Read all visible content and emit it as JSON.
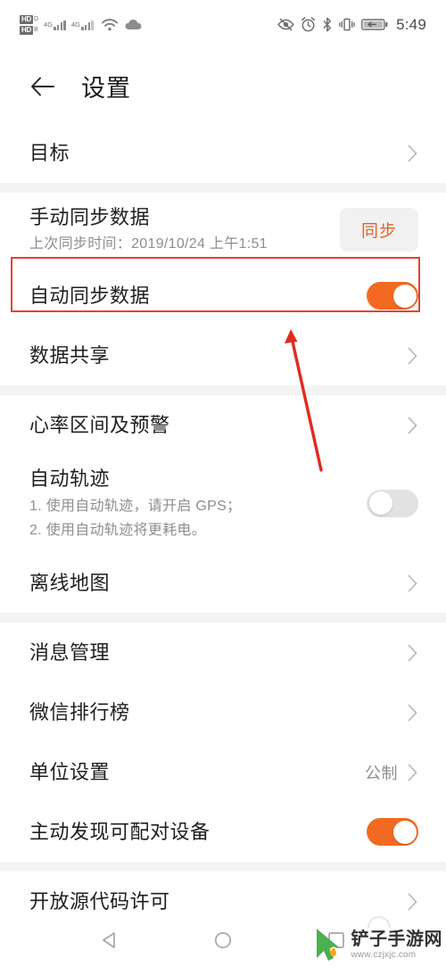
{
  "status_bar": {
    "hd_badges": [
      {
        "label": "HD",
        "sub": "D"
      },
      {
        "label": "HD",
        "sub": "B"
      }
    ],
    "network_labels": [
      "4G",
      "4G"
    ],
    "icons": [
      "wifi-icon",
      "cloud-icon",
      "eye-off-icon",
      "alarm-clock-icon",
      "bluetooth-icon",
      "vibrate-icon",
      "battery-charging-icon"
    ],
    "time": "5:49"
  },
  "header": {
    "back_icon": "back-arrow-icon",
    "title": "设置"
  },
  "sections": [
    {
      "id": "goal",
      "rows": [
        {
          "type": "link",
          "title": "目标"
        }
      ]
    },
    {
      "id": "sync",
      "rows": [
        {
          "type": "sync",
          "title": "手动同步数据",
          "subtitle": "上次同步时间：2019/10/24 上午1:51",
          "button": "同步"
        },
        {
          "type": "toggle",
          "title": "自动同步数据",
          "state": "on",
          "highlighted": true
        },
        {
          "type": "link",
          "title": "数据共享"
        }
      ]
    },
    {
      "id": "tracking",
      "rows": [
        {
          "type": "link",
          "title": "心率区间及预警"
        },
        {
          "type": "toggle-multi",
          "title": "自动轨迹",
          "lines": [
            "1. 使用自动轨迹，请开启 GPS；",
            "2. 使用自动轨迹将更耗电。"
          ],
          "state": "off"
        },
        {
          "type": "link",
          "title": "离线地图"
        }
      ]
    },
    {
      "id": "misc",
      "rows": [
        {
          "type": "link",
          "title": "消息管理"
        },
        {
          "type": "link",
          "title": "微信排行榜"
        },
        {
          "type": "value-link",
          "title": "单位设置",
          "value": "公制"
        },
        {
          "type": "toggle",
          "title": "主动发现可配对设备",
          "state": "on"
        }
      ]
    },
    {
      "id": "legal",
      "rows": [
        {
          "type": "link",
          "title": "开放源代码许可"
        }
      ]
    }
  ],
  "annotations": {
    "highlight_box_color": "#e8412c",
    "arrow_color": "#e02b1e",
    "arrow_target": "自动同步数据"
  },
  "nav_bar": {
    "back": "nav-back-icon",
    "home": "nav-home-icon",
    "recents": "nav-recents-icon"
  },
  "watermark": {
    "name": "铲子手游网",
    "url": "www.czjxjc.com",
    "logo_color": "#4caf50"
  }
}
